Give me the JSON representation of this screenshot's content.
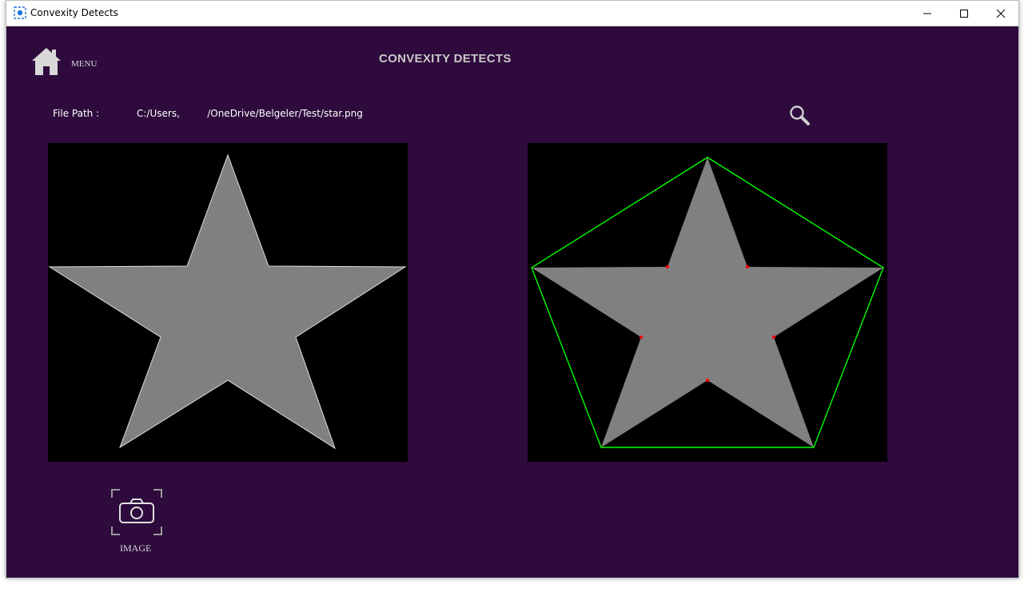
{
  "window": {
    "title": "Convexity Detects",
    "icon": "app-icon",
    "controls": [
      "minimize-icon",
      "maximize-icon",
      "close-icon"
    ]
  },
  "header": {
    "menu_icon": "home-icon",
    "menu_label": "MENU",
    "title": "CONVEXITY DETECTS"
  },
  "file": {
    "label": "File Path :",
    "value": "C:/Users,         /OneDrive/Belgeler/Test/star.png",
    "search_icon": "search-icon"
  },
  "image_button": {
    "icon": "camera-icon",
    "label": "IMAGE"
  },
  "colors": {
    "background": "#2e0a3d",
    "star_fill": "#808080",
    "hull_color": "#00ff00",
    "defect_color": "#ff0000"
  }
}
